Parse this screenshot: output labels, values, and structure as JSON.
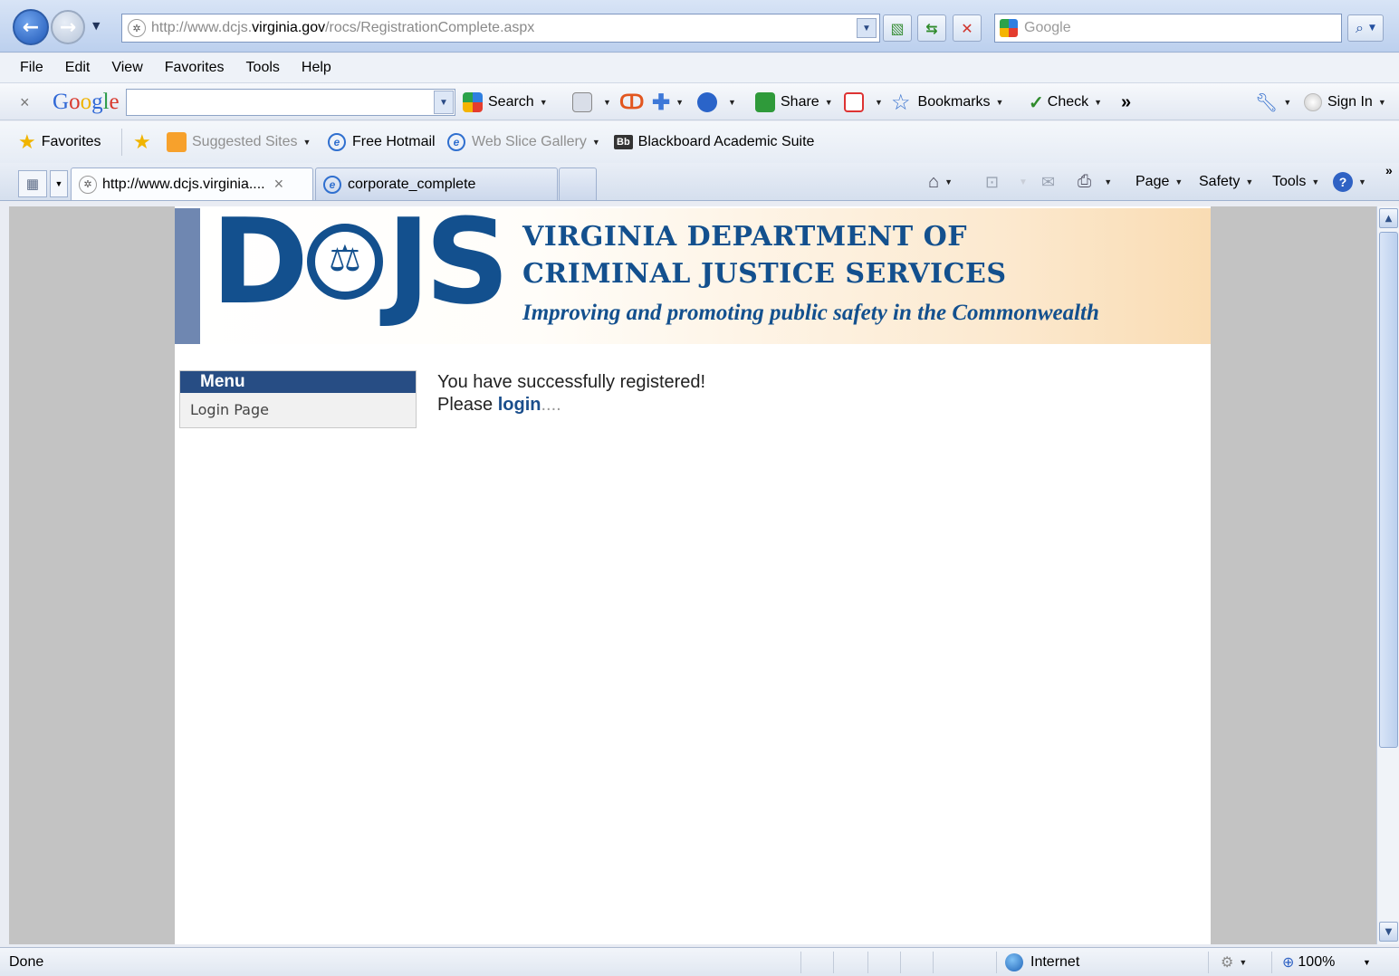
{
  "browser": {
    "address": {
      "url_prefix": "http://www.dcjs.",
      "url_domain": "virginia.gov",
      "url_path": "/rocs/RegistrationComplete.aspx"
    },
    "search_placeholder": "Google",
    "menu": [
      "File",
      "Edit",
      "View",
      "Favorites",
      "Tools",
      "Help"
    ],
    "google_toolbar": {
      "close": "×",
      "logo": "Google",
      "search": "Search",
      "share": "Share",
      "bookmarks": "Bookmarks",
      "check": "Check",
      "more": "»",
      "sign_in": "Sign In"
    },
    "favorites_bar": {
      "favorites": "Favorites",
      "suggested_sites": "Suggested Sites",
      "free_hotmail": "Free Hotmail",
      "web_slice_gallery": "Web Slice Gallery",
      "blackboard_icon": "Bb",
      "blackboard": "Blackboard Academic Suite"
    },
    "tabs": [
      {
        "label": "http://www.dcjs.virginia...."
      },
      {
        "label": "corporate_complete"
      }
    ],
    "command_bar": {
      "page": "Page",
      "safety": "Safety",
      "tools": "Tools",
      "more": "»"
    },
    "status": {
      "text": "Done",
      "zone": "Internet",
      "zoom": "100%"
    }
  },
  "site": {
    "logo_left": "D",
    "logo_right": "JS",
    "agency_line1": "VIRGINIA DEPARTMENT OF",
    "agency_line2": "CRIMINAL JUSTICE SERVICES",
    "tagline": "Improving and promoting public safety in the Commonwealth",
    "menu_title": "Menu",
    "menu_items": [
      "Login Page"
    ],
    "message_line1": "You have successfully registered!",
    "message_please": "Please ",
    "message_link": "login",
    "message_dots": "...."
  },
  "colors": {
    "brand_blue": "#13508e",
    "menu_header": "#274d84",
    "banner_stripe": "#6f87b1"
  }
}
